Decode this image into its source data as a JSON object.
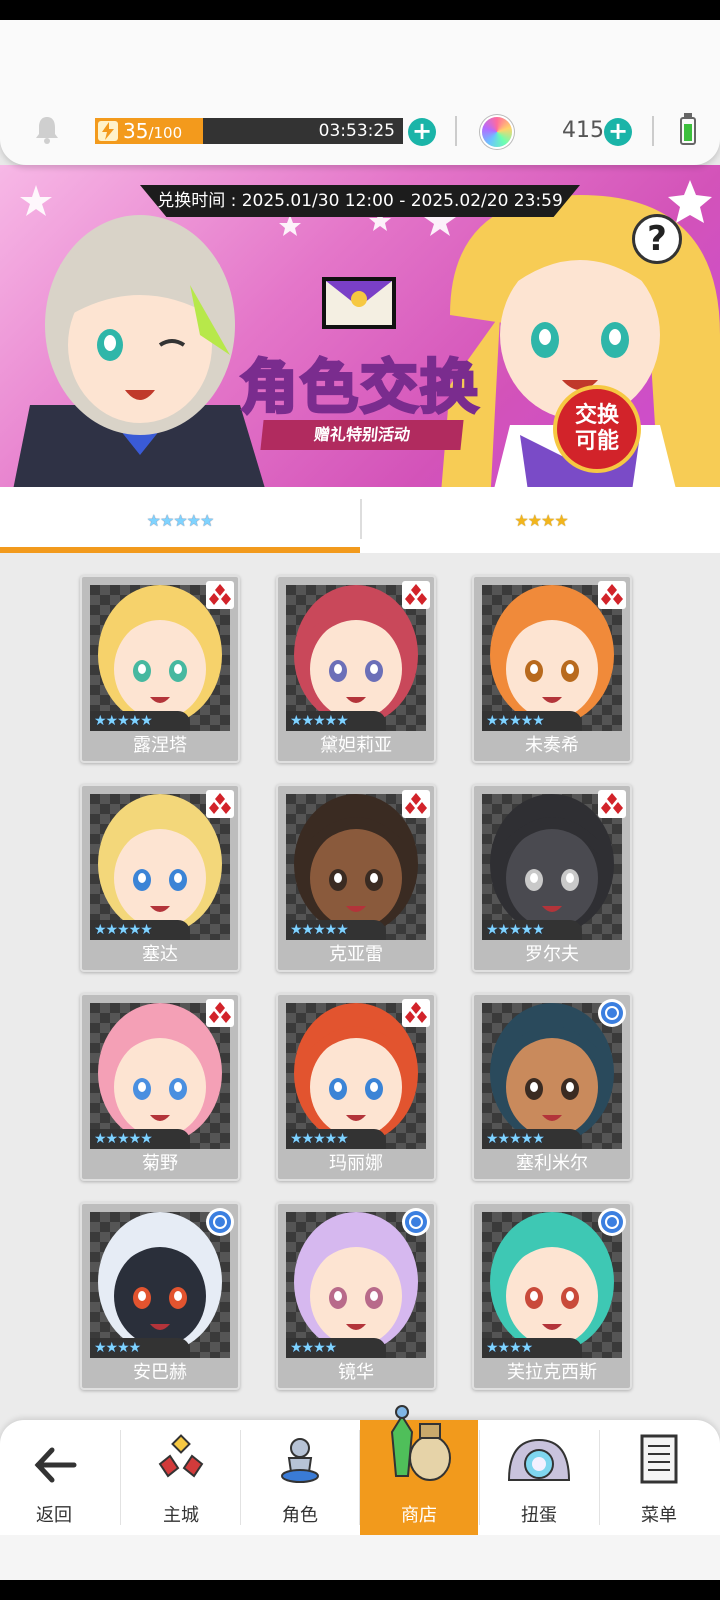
{
  "header": {
    "energy_current": "35",
    "energy_max": "/100",
    "energy_fill_fraction": 0.35,
    "energy_timer": "03:53:25",
    "gem_count": "415"
  },
  "banner": {
    "period": "兑换时间 : 2025.01/30 12:00 - 2025.02/20 23:59",
    "title": "角色交换",
    "subtitle": "赠礼特别活动",
    "seal_line1": "交换",
    "seal_line2": "可能",
    "help": "?"
  },
  "tabs": [
    {
      "stars": "★★★★★",
      "active": true
    },
    {
      "stars": "★★★★",
      "active": false
    }
  ],
  "characters": [
    {
      "name": "露涅塔",
      "stars": "★★★★★",
      "badge": "red-diamond",
      "hair": "#f6d26b",
      "skin": "#fde4d2",
      "eyes": "#46b8a0"
    },
    {
      "name": "黛妲莉亚",
      "stars": "★★★★★",
      "badge": "red-diamond",
      "hair": "#c9485a",
      "skin": "#fde4d2",
      "eyes": "#6b6fb8"
    },
    {
      "name": "未奏希",
      "stars": "★★★★★",
      "badge": "red-diamond",
      "hair": "#f08a3a",
      "skin": "#fde4d2",
      "eyes": "#b86a1e"
    },
    {
      "name": "塞达",
      "stars": "★★★★★",
      "badge": "red-diamond",
      "hair": "#f3d77a",
      "skin": "#fde4d2",
      "eyes": "#3b84d6"
    },
    {
      "name": "克亚雷",
      "stars": "★★★★★",
      "badge": "red-diamond",
      "hair": "#3a2b22",
      "skin": "#8a5a3c",
      "eyes": "#3a2b22"
    },
    {
      "name": "罗尔夫",
      "stars": "★★★★★",
      "badge": "red-diamond",
      "hair": "#2f2f33",
      "skin": "#4a4a50",
      "eyes": "#c9c9c9"
    },
    {
      "name": "菊野",
      "stars": "★★★★★",
      "badge": "red-diamond",
      "hair": "#f4a0b6",
      "skin": "#fde4d2",
      "eyes": "#4a8fe0"
    },
    {
      "name": "玛丽娜",
      "stars": "★★★★★",
      "badge": "red-diamond",
      "hair": "#e2542f",
      "skin": "#fde4d2",
      "eyes": "#3b84d6"
    },
    {
      "name": "塞利米尔",
      "stars": "★★★★★",
      "badge": "blue-circle",
      "hair": "#2a4a5c",
      "skin": "#c98a5c",
      "eyes": "#3a2b22"
    },
    {
      "name": "安巴赫",
      "stars": "★★★★",
      "badge": "blue-circle",
      "hair": "#e6ecf5",
      "skin": "#2a2f3a",
      "eyes": "#e2542f"
    },
    {
      "name": "镜华",
      "stars": "★★★★",
      "badge": "blue-circle",
      "hair": "#d6b8ef",
      "skin": "#fde4d2",
      "eyes": "#b86a8a"
    },
    {
      "name": "芙拉克西斯",
      "stars": "★★★★",
      "badge": "blue-circle",
      "hair": "#3ec8b4",
      "skin": "#fde4d2",
      "eyes": "#c94a3a"
    }
  ],
  "nav": {
    "back": "返回",
    "items": [
      {
        "label": "主城",
        "icon": "castle-icon",
        "active": false
      },
      {
        "label": "角色",
        "icon": "character-icon",
        "active": false
      },
      {
        "label": "商店",
        "icon": "shop-icon",
        "active": true
      },
      {
        "label": "扭蛋",
        "icon": "gacha-icon",
        "active": false
      },
      {
        "label": "菜单",
        "icon": "menu-icon",
        "active": false
      }
    ]
  },
  "colors": {
    "accent": "#f29a1c",
    "teal": "#1ab4a8",
    "banner_pink": "#e476c9"
  }
}
